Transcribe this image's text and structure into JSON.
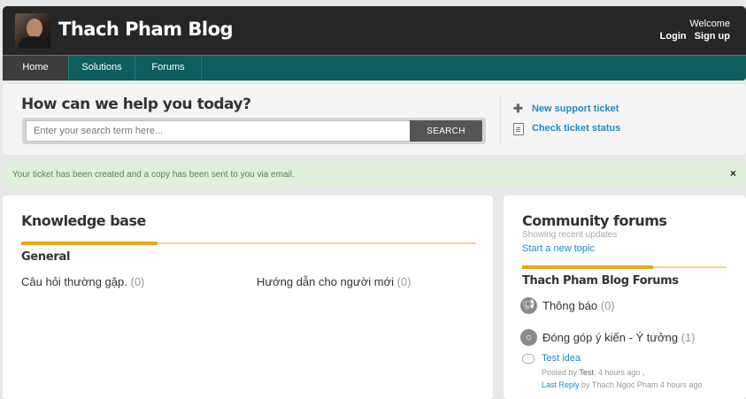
{
  "header": {
    "site_title": "Thach Pham Blog",
    "welcome": "Welcome",
    "login": "Login",
    "signup": "Sign up"
  },
  "nav": {
    "items": [
      "Home",
      "Solutions",
      "Forums"
    ],
    "active": "Home"
  },
  "search": {
    "title": "How can we help you today?",
    "placeholder": "Enter your search term here...",
    "button": "SEARCH"
  },
  "side_links": {
    "new_ticket": "New support ticket",
    "check_status": "Check ticket status"
  },
  "flash": {
    "message": "Your ticket has been created and a copy has been sent to you via email.",
    "close": "×"
  },
  "knowledge_base": {
    "title": "Knowledge base",
    "section": "General",
    "categories": [
      {
        "name": "Câu hỏi thường gặp.",
        "count": "(0)"
      },
      {
        "name": "Hướng dẫn cho người mới",
        "count": "(0)"
      }
    ]
  },
  "community": {
    "title": "Community forums",
    "subtitle": "Showing recent updates",
    "new_topic": "Start a new topic",
    "forums_title": "Thach Pham Blog Forums",
    "forums": [
      {
        "name": "Thông báo",
        "count": "(0)",
        "icon": "megaphone-icon"
      },
      {
        "name": "Đóng góp ý kiến - Ý tưởng",
        "count": "(1)",
        "icon": "lightbulb-icon"
      }
    ],
    "topic": {
      "title": "Test idea",
      "posted_by_label": "Posted by",
      "posted_by": "Test",
      "posted_time": ", 4 hours ago ,",
      "last_reply_label": "Last Reply",
      "last_reply_by_label": "by",
      "last_reply_by": "Thach Ngoc Pham",
      "last_reply_time": "4 hours ago"
    }
  },
  "colors": {
    "header_bg": "#262626",
    "nav_bg": "#0d5e5c",
    "link": "#1f8ac6",
    "accent": "#e8a61f",
    "flash_bg": "#e0f0dc"
  }
}
